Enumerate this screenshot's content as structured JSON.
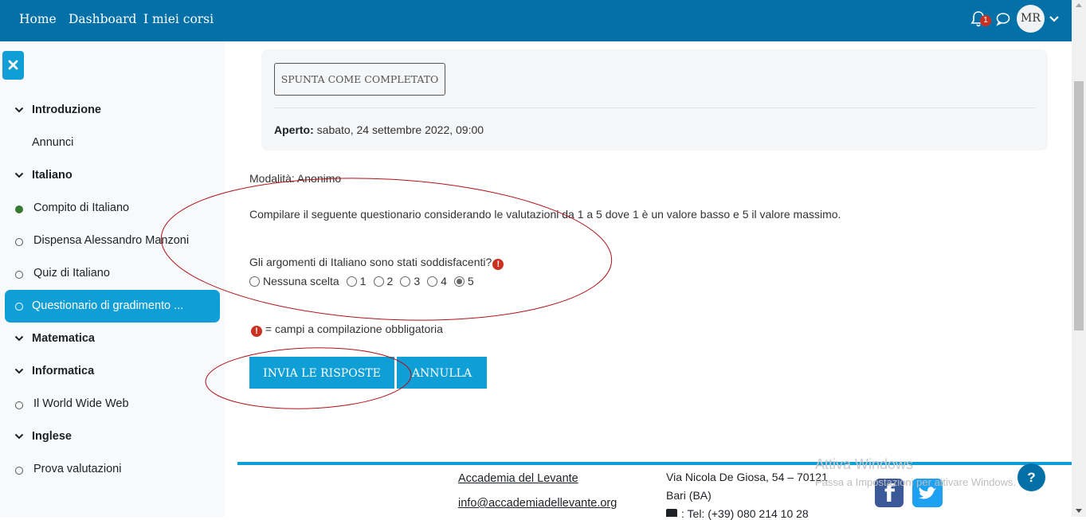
{
  "nav": {
    "links": [
      "Home",
      "Dashboard",
      "I miei corsi"
    ],
    "notification_count": "1",
    "avatar_initials": "MR"
  },
  "drawer": {
    "sections": [
      {
        "title": "Introduzione",
        "items": [
          {
            "label": "Annunci",
            "status": "none"
          }
        ]
      },
      {
        "title": "Italiano",
        "items": [
          {
            "label": "Compito di Italiano",
            "status": "complete"
          },
          {
            "label": "Dispensa Alessandro Manzoni",
            "status": "incomplete"
          },
          {
            "label": "Quiz di Italiano",
            "status": "incomplete"
          },
          {
            "label": "Questionario di gradimento ...",
            "status": "incomplete",
            "active": true
          }
        ]
      },
      {
        "title": "Matematica",
        "items": []
      },
      {
        "title": "Informatica",
        "items": [
          {
            "label": "Il World Wide Web",
            "status": "incomplete"
          }
        ]
      },
      {
        "title": "Inglese",
        "items": [
          {
            "label": "Prova valutazioni",
            "status": "incomplete"
          }
        ]
      }
    ]
  },
  "activity": {
    "completion_button": "SPUNTA COME COMPLETATO",
    "opened_label": "Aperto:",
    "opened_value": " sabato, 24 settembre 2022, 09:00"
  },
  "feedback": {
    "mode": "Modalità: Anonimo",
    "intro": "Compilare il seguente questionario considerando le valutazioni da 1 a 5 dove 1 è un valore basso e 5 il valore massimo.",
    "question": "Gli argomenti di Italiano sono stati soddisfacenti?",
    "required_icon": "!",
    "options": [
      "Nessuna scelta",
      "1",
      "2",
      "3",
      "4",
      "5"
    ],
    "selected_option": "5",
    "legend": " = campi a compilazione obbligatoria",
    "submit_label": "INVIA LE RISPOSTE",
    "cancel_label": "ANNULLA"
  },
  "footer": {
    "org_name": "Accademia del Levante",
    "email": "info@accademiadellevante.org",
    "address_line1": "Via Nicola De Giosa, 54 – 70121",
    "address_line2": "Bari (BA)",
    "phone": ": Tel: (+39) 080 214 10 28"
  },
  "windows_watermark": {
    "title": "Attiva Windows",
    "subtitle": "Passa a Impostazioni per attivare Windows."
  },
  "help_label": "?",
  "colors": {
    "navbar": "#0470a8",
    "primary": "#0f9ed5",
    "danger": "#ca3120",
    "success": "#357a32",
    "annotation": "#b01018"
  }
}
